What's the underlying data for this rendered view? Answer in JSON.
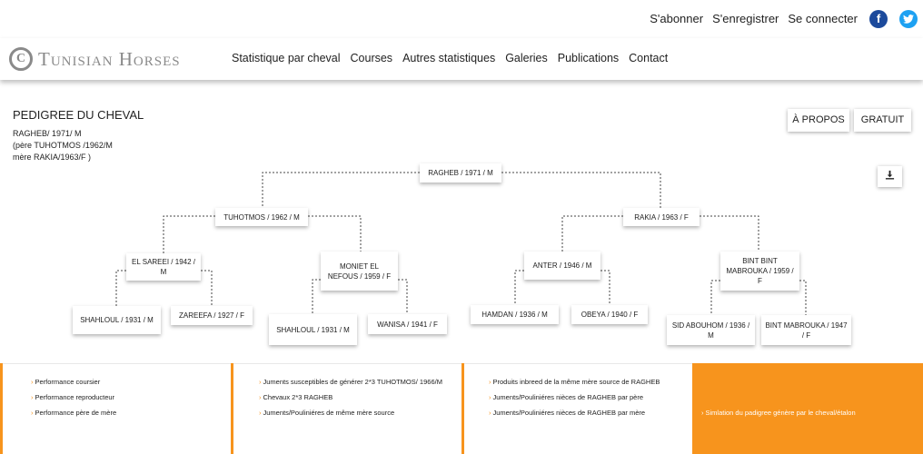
{
  "header": {
    "links": [
      "S'abonner",
      "S'enregistrer",
      "Se connecter"
    ],
    "facebook_icon": "f",
    "twitter_icon": "t"
  },
  "logo": {
    "mark": "C",
    "text": "Tunisian Horses"
  },
  "nav": [
    "Statistique par cheval",
    "Courses",
    "Autres statistiques",
    "Galeries",
    "Publications",
    "Contact"
  ],
  "page": {
    "title": "PEDIGREE DU CHEVAL",
    "info": [
      "RAGHEB/ 1971/ M",
      "(père TUHOTMOS /1962/M",
      "mère RAKIA/1963/F )"
    ],
    "btn_apropos": "À PROPOS",
    "btn_gratuit": "GRATUIT",
    "download_icon": "download-icon"
  },
  "pedigree": {
    "root": "RAGHEB / 1971 / M",
    "sire": "TUHOTMOS / 1962 / M",
    "dam": "RAKIA / 1963 / F",
    "ss": "EL SAREEI / 1942 / M",
    "sd": "MONIET EL NEFOUS / 1959 / F",
    "ds": "ANTER / 1946 / M",
    "dd": "BINT BINT MABROUKA / 1959 / F",
    "sss": "SHAHLOUL / 1931 / M",
    "ssd": "ZAREEFA / 1927 / F",
    "sds": "SHAHLOUL / 1931 / M",
    "sdd": "WANISA / 1941 / F",
    "dss": "HAMDAN / 1936 / M",
    "dsd": "OBEYA / 1940 / F",
    "dds": "SID ABOUHOM / 1936 / M",
    "ddd": "BINT MABROUKA / 1947 / F"
  },
  "panels": {
    "p1": [
      "Performance coursier",
      "Performance reproducteur",
      "Performance père de mère"
    ],
    "p2": [
      "Juments susceptibles de générer 2*3 TUHOTMOS/ 1966/M",
      "Chevaux 2*3 RAGHEB",
      "Juments/Pouliniéres de même mère source"
    ],
    "p3": [
      "Produits inbreed de la même mère source de RAGHEB",
      "Juments/Pouliniéres nièces de RAGHEB par père",
      "Juments/Pouliniéres nièces de RAGHEB par mère"
    ],
    "p4": "Simlation du padigree génère par le cheval/étalon"
  },
  "colors": {
    "accent": "#f7941d",
    "facebook": "#1c4a9c",
    "twitter": "#1da1f2"
  }
}
